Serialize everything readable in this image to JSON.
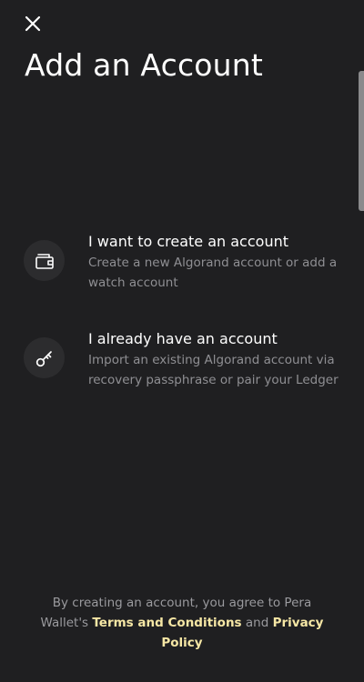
{
  "header": {
    "close_icon": "close-icon",
    "title": "Add an Account"
  },
  "options": [
    {
      "icon": "wallet-icon",
      "title": "I want to create an account",
      "description": "Create a new Algorand account or add a watch account"
    },
    {
      "icon": "key-icon",
      "title": "I already have an account",
      "description": "Import an existing Algorand account via recovery passphrase or pair your Ledger"
    }
  ],
  "footer": {
    "prefix": "By creating an account, you agree to Pera Wallet's",
    "terms_link": "Terms and Conditions",
    "conjunction": "and",
    "privacy_link": "Privacy Policy"
  },
  "colors": {
    "background": "#1f1f21",
    "icon_circle": "#2c2c2e",
    "secondary_text": "#8f8f93",
    "link": "#f6e7a5"
  }
}
